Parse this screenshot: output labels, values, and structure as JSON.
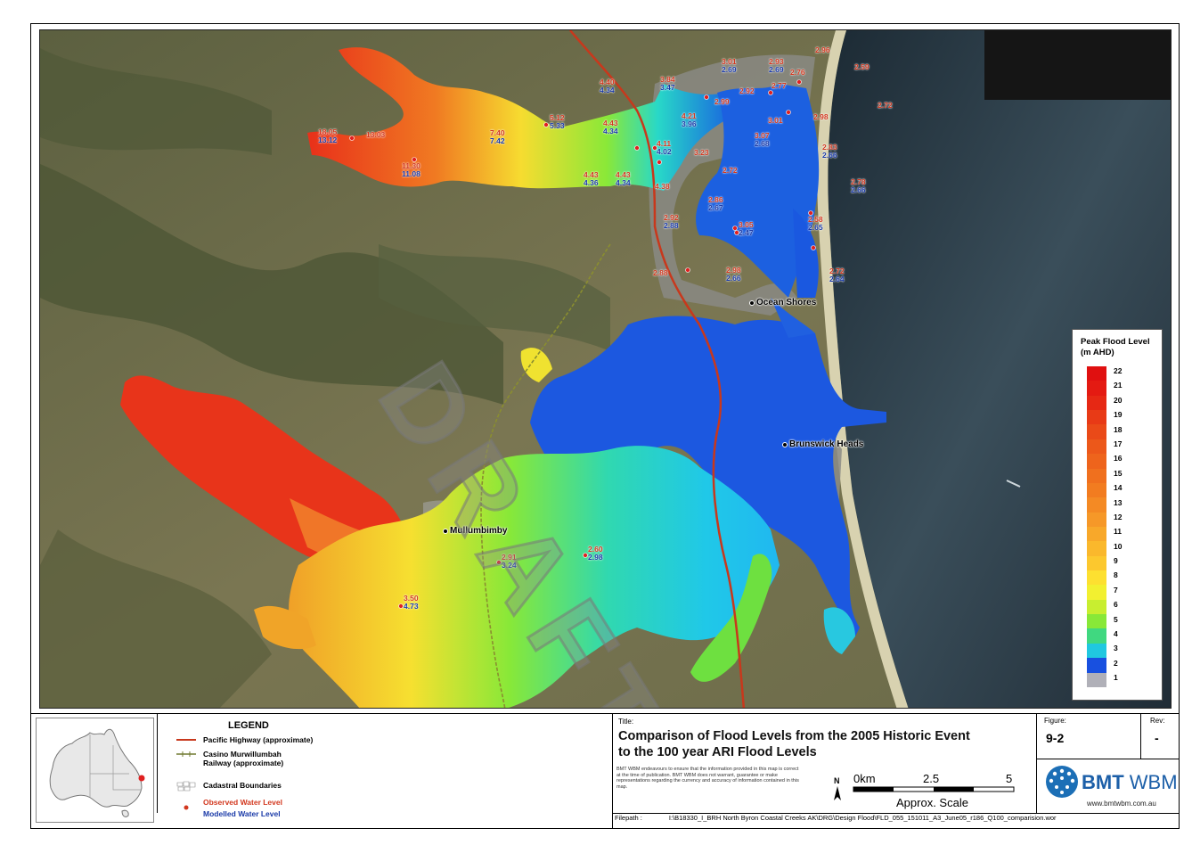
{
  "map": {
    "watermark": "DRAFT",
    "towns": [
      {
        "name": "Ocean Shores"
      },
      {
        "name": "Brunswick Heads"
      },
      {
        "name": "Mullumbimby"
      }
    ],
    "levels": [
      {
        "obs": "18.05",
        "mod": "13.12"
      },
      {
        "obs": "13.03",
        "mod": ""
      },
      {
        "obs": "11.30",
        "mod": "11.08"
      },
      {
        "obs": "7.40",
        "mod": "7.42"
      },
      {
        "obs": "5.12",
        "mod": "5.33"
      },
      {
        "obs": "4.40",
        "mod": "4.34"
      },
      {
        "obs": "4.43",
        "mod": "4.34"
      },
      {
        "obs": "4.43",
        "mod": "4.36"
      },
      {
        "obs": "4.43",
        "mod": "4.34"
      },
      {
        "obs": "4.11",
        "mod": "4.02"
      },
      {
        "obs": "4.21",
        "mod": "3.96"
      },
      {
        "obs": "3.84",
        "mod": "3.47"
      },
      {
        "obs": "4.38",
        "mod": ""
      },
      {
        "obs": "3.23",
        "mod": ""
      },
      {
        "obs": "2.99",
        "mod": ""
      },
      {
        "obs": "3.01",
        "mod": "2.69"
      },
      {
        "obs": "2.93",
        "mod": "2.69"
      },
      {
        "obs": "2.76",
        "mod": ""
      },
      {
        "obs": "2.77",
        "mod": ""
      },
      {
        "obs": "2.92",
        "mod": ""
      },
      {
        "obs": "3.01",
        "mod": ""
      },
      {
        "obs": "3.07",
        "mod": "2.68"
      },
      {
        "obs": "2.96",
        "mod": ""
      },
      {
        "obs": "2.59",
        "mod": ""
      },
      {
        "obs": "2.72",
        "mod": ""
      },
      {
        "obs": "2.98",
        "mod": ""
      },
      {
        "obs": "2.83",
        "mod": "2.66"
      },
      {
        "obs": "2.72",
        "mod": ""
      },
      {
        "obs": "2.86",
        "mod": "2.67"
      },
      {
        "obs": "2.78",
        "mod": "2.66"
      },
      {
        "obs": "2.92",
        "mod": "2.88"
      },
      {
        "obs": "3.05",
        "mod": "2.47"
      },
      {
        "obs": "2.58",
        "mod": "2.65"
      },
      {
        "obs": "2.88",
        "mod": ""
      },
      {
        "obs": "2.98",
        "mod": "2.66"
      },
      {
        "obs": "2.72",
        "mod": "2.64"
      },
      {
        "obs": "2.91",
        "mod": "3.24"
      },
      {
        "obs": "2.60",
        "mod": "2.98"
      },
      {
        "obs": "3.50",
        "mod": "4.73"
      }
    ]
  },
  "color_legend": {
    "title_line1": "Peak Flood Level",
    "title_line2": "(m AHD)",
    "ticks": [
      "22",
      "21",
      "20",
      "19",
      "18",
      "17",
      "16",
      "15",
      "14",
      "13",
      "12",
      "11",
      "10",
      "9",
      "8",
      "7",
      "6",
      "5",
      "4",
      "3",
      "2",
      "1"
    ],
    "colors": [
      "#e01010",
      "#e41a12",
      "#e62814",
      "#e83a16",
      "#ea4a18",
      "#ec581a",
      "#ee641c",
      "#f0701e",
      "#f27c20",
      "#f48a24",
      "#f69828",
      "#f8a82a",
      "#fab82c",
      "#fcc82e",
      "#fde030",
      "#f2f030",
      "#c8ee30",
      "#88e838",
      "#40d880",
      "#20c8e0",
      "#1850e0",
      "#b0b0b8"
    ]
  },
  "legend": {
    "title": "LEGEND",
    "items": [
      {
        "label": "Pacific Highway (approximate)",
        "color": "#c8381c"
      },
      {
        "label": "Casino Murwillumbah",
        "label2": "Railway (approximate)",
        "color": "#707a30"
      },
      {
        "label": "Cadastral Boundaries",
        "color": "#888888"
      },
      {
        "label": "Observed Water Level",
        "color": "#d2381f"
      },
      {
        "label": "Modelled Water Level",
        "color": "#1a3aa8"
      }
    ]
  },
  "title_block": {
    "title_caption": "Title:",
    "title_line1": "Comparison of Flood Levels from the 2005 Historic Event",
    "title_line2": "to the 100 year ARI Flood Levels",
    "disclaimer": "BMT WBM endeavours to ensure that the information provided in this map is correct at the time of publication. BMT WBM does not warrant, guarantee or make representations regarding the currency and accuracy of information contained in this map.",
    "filepath_caption": "Filepath :",
    "filepath": "I:\\B18330_I_BRH North Byron Coastal Creeks AK\\DRG\\Design Flood\\FLD_055_151011_A3_June05_r186_Q100_comparision.wor"
  },
  "figure": {
    "caption": "Figure:",
    "value": "9-2",
    "rev_caption": "Rev:",
    "rev": "-"
  },
  "scale": {
    "label0": "0km",
    "label1": "2.5",
    "label2": "5",
    "caption": "Approx. Scale",
    "north": "N"
  },
  "company": {
    "name_bold": "BMT",
    "name_light": "WBM",
    "url": "www.bmtwbm.com.au"
  }
}
